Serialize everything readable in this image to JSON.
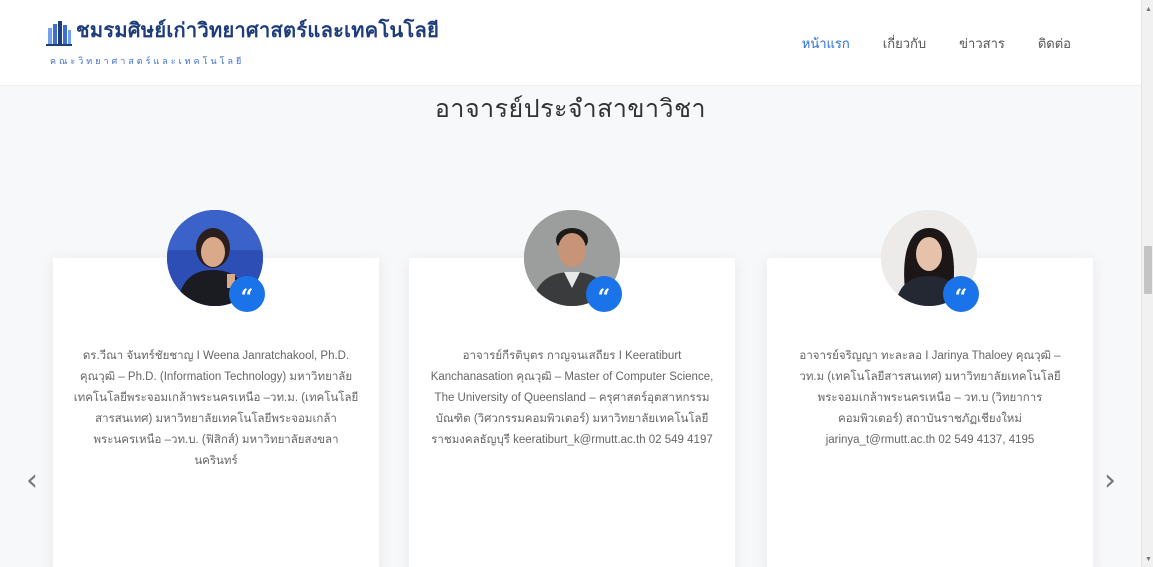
{
  "header": {
    "site_title": "ชมรมศิษย์เก่าวิทยาศาสตร์และเทคโนโลยี",
    "site_subtitle": "คณะวิทยาศาสตร์และเทคโนโลยี",
    "nav": [
      {
        "label": "หน้าแรก",
        "active": true
      },
      {
        "label": "เกี่ยวกับ",
        "active": false
      },
      {
        "label": "ข่าวสาร",
        "active": false
      },
      {
        "label": "ติดต่อ",
        "active": false
      }
    ]
  },
  "section": {
    "title": "อาจารย์ประจำสาขาวิชา"
  },
  "cards": [
    {
      "text": "ดร.วีณา จันทร์ชัยชาญ I Weena Janratchakool, Ph.D. คุณวุฒิ – Ph.D. (Information Technology) มหาวิทยาลัยเทคโนโลยีพระจอมเกล้าพระนครเหนือ –วท.ม. (เทคโนโลยีสารสนเทศ) มหาวิทยาลัยเทคโนโลยีพระจอมเกล้าพระนครเหนือ –วท.บ. (ฟิสิกส์) มหาวิทยาลัยสงขลานครินทร์"
    },
    {
      "text": "อาจารย์กีรติบุตร กาญจนเสถียร I Keeratiburt Kanchanasation คุณวุฒิ – Master of Computer Science, The University of Queensland – ครุศาสตร์อุตสาหกรรมบัณฑิต (วิศวกรรมคอมพิวเตอร์) มหาวิทยาลัยเทคโนโลยีราชมงคลธัญบุรี keeratiburt_k@rmutt.ac.th 02 549 4197"
    },
    {
      "text": "อาจารย์จริญญา ทะละลอ I Jarinya Thaloey คุณวุฒิ – วท.ม (เทคโนโลยีสารสนเทศ) มหาวิทยาลัยเทคโนโลยีพระจอมเกล้าพระนครเหนือ – วท.บ (วิทยาการคอมพิวเตอร์) สถาบันราชภัฏเชียงใหม่ jarinya_t@rmutt.ac.th 02 549 4137, 4195"
    }
  ],
  "carousel": {
    "prev_glyph": "‹",
    "next_glyph": "›"
  },
  "scrollbar": {
    "up_glyph": "▲",
    "down_glyph": "▼"
  },
  "colors": {
    "accent": "#1a73e8",
    "brand_title": "#1f3d7a",
    "nav_active": "#2a6fe0",
    "page_bg": "#f7f8f9"
  },
  "icons": {
    "quote_badge": "quote-icon",
    "logo": "building-logo-icon"
  },
  "quote_glyph": "“"
}
